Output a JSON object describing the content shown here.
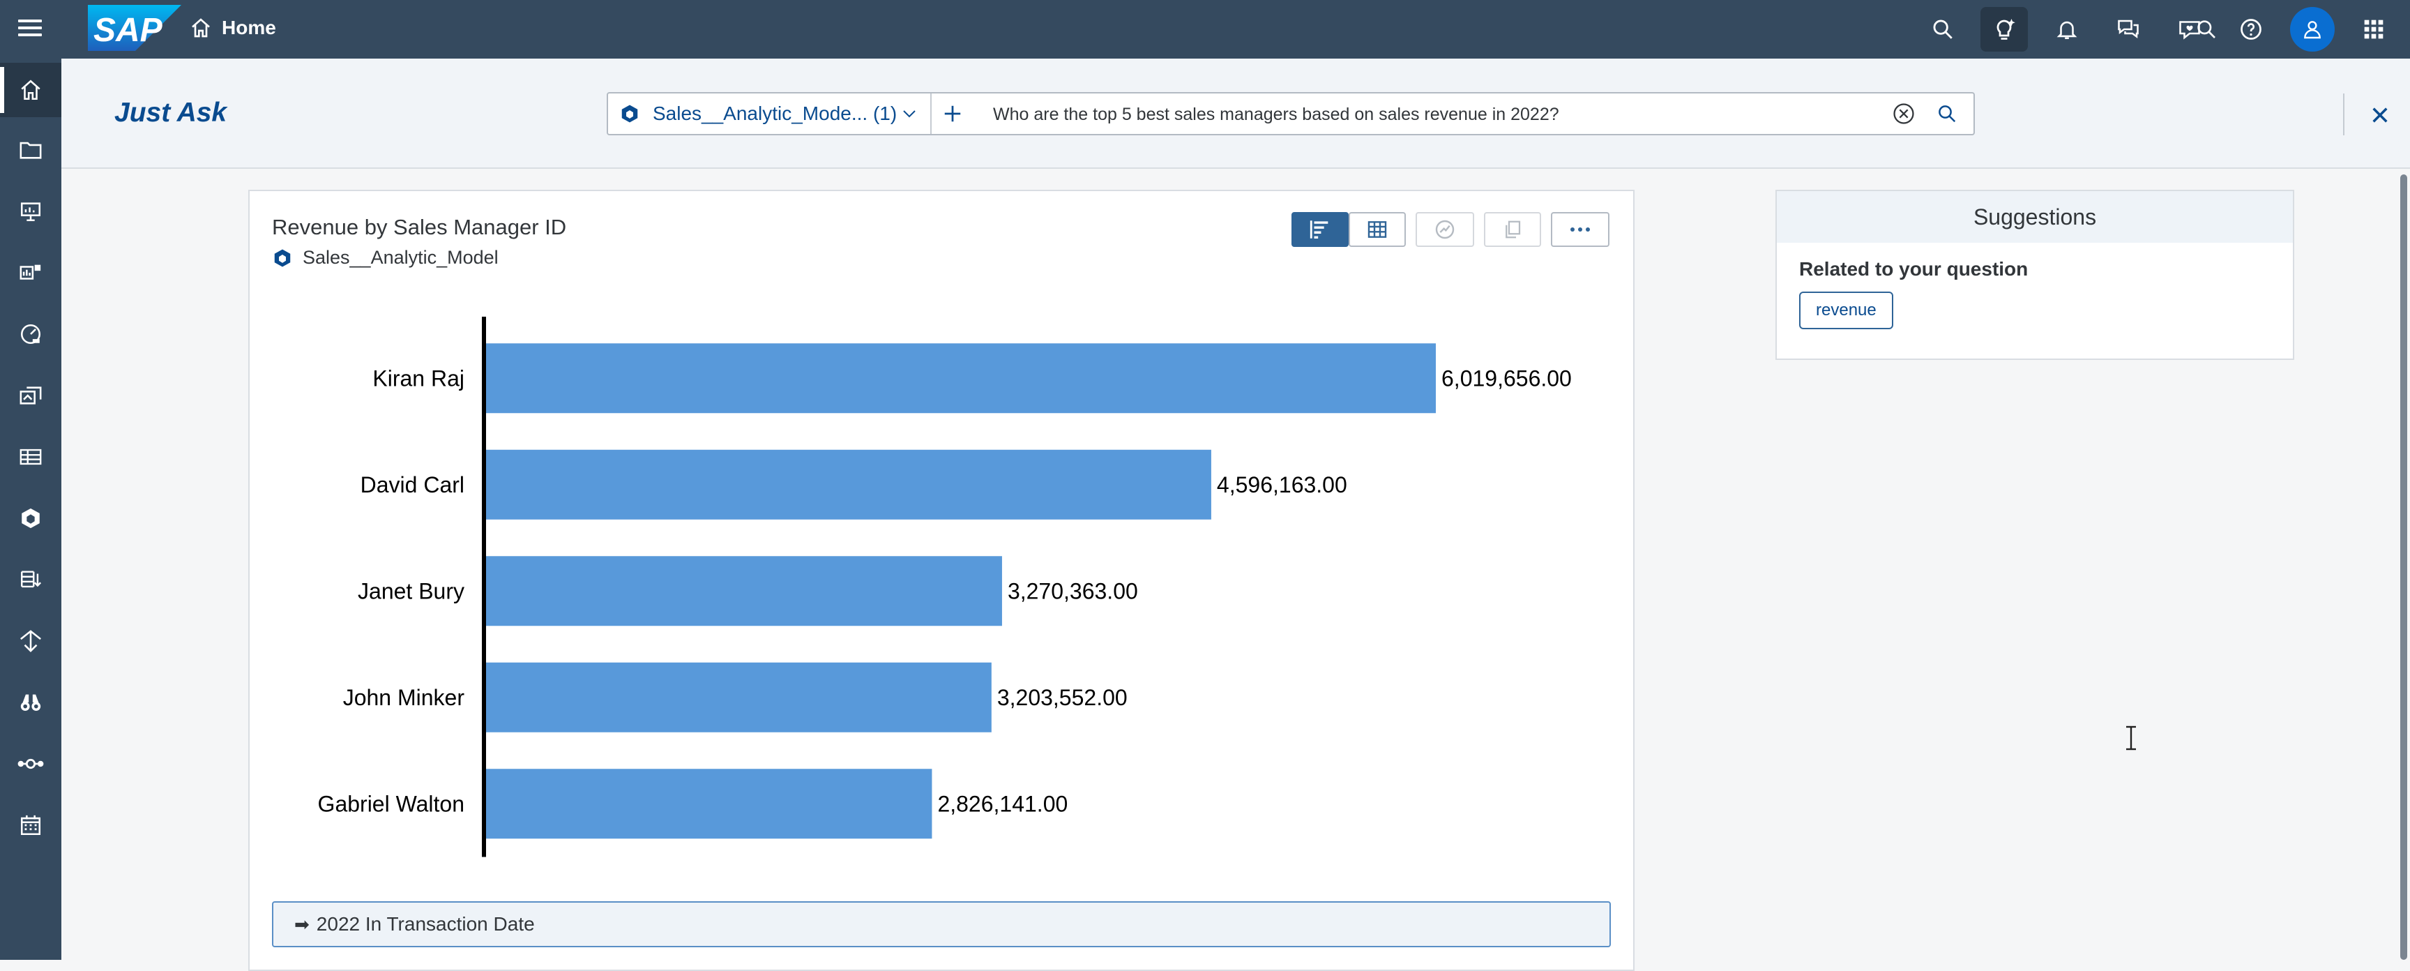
{
  "shell": {
    "home_label": "Home",
    "logo_text": "SAP",
    "brand_color": "#354a5f",
    "accent_color": "#0a6ed1",
    "actions": [
      "search-icon",
      "ai-assistant-icon",
      "notifications-icon",
      "discussions-icon",
      "feedback-icon",
      "help-icon",
      "user-avatar-icon",
      "app-grid-icon"
    ]
  },
  "sidenav": {
    "items": [
      "home-icon",
      "files-icon",
      "stories-icon",
      "analytic-app-icon",
      "digital-boardroom-icon",
      "modeler-icon",
      "data-sources-icon",
      "model-icon",
      "data-import-icon",
      "data-action-icon",
      "insights-icon",
      "connections-icon",
      "calendar-icon"
    ]
  },
  "header": {
    "title": "Just Ask",
    "model_select": "Sales__Analytic_Mode... (1)",
    "query": "Who are the top 5 best sales managers based on sales revenue in 2022?"
  },
  "card": {
    "title": "Revenue by Sales Manager ID",
    "model_name": "Sales__Analytic_Model",
    "filter": "2022 In Transaction Date"
  },
  "suggestions": {
    "header": "Suggestions",
    "subheading": "Related to your question",
    "chips": [
      "revenue"
    ]
  },
  "chart_data": {
    "type": "bar",
    "orientation": "horizontal",
    "categories": [
      "Kiran Raj",
      "David Carl",
      "Janet Bury",
      "John Minker",
      "Gabriel Walton"
    ],
    "values": [
      6019656.0,
      4596163.0,
      3270363.0,
      3203552.0,
      2826141.0
    ],
    "value_labels": [
      "6,019,656.00",
      "4,596,163.00",
      "3,270,363.00",
      "3,203,552.00",
      "2,826,141.00"
    ],
    "bar_color": "#5899da",
    "xlim": [
      0,
      6019656.0
    ]
  }
}
